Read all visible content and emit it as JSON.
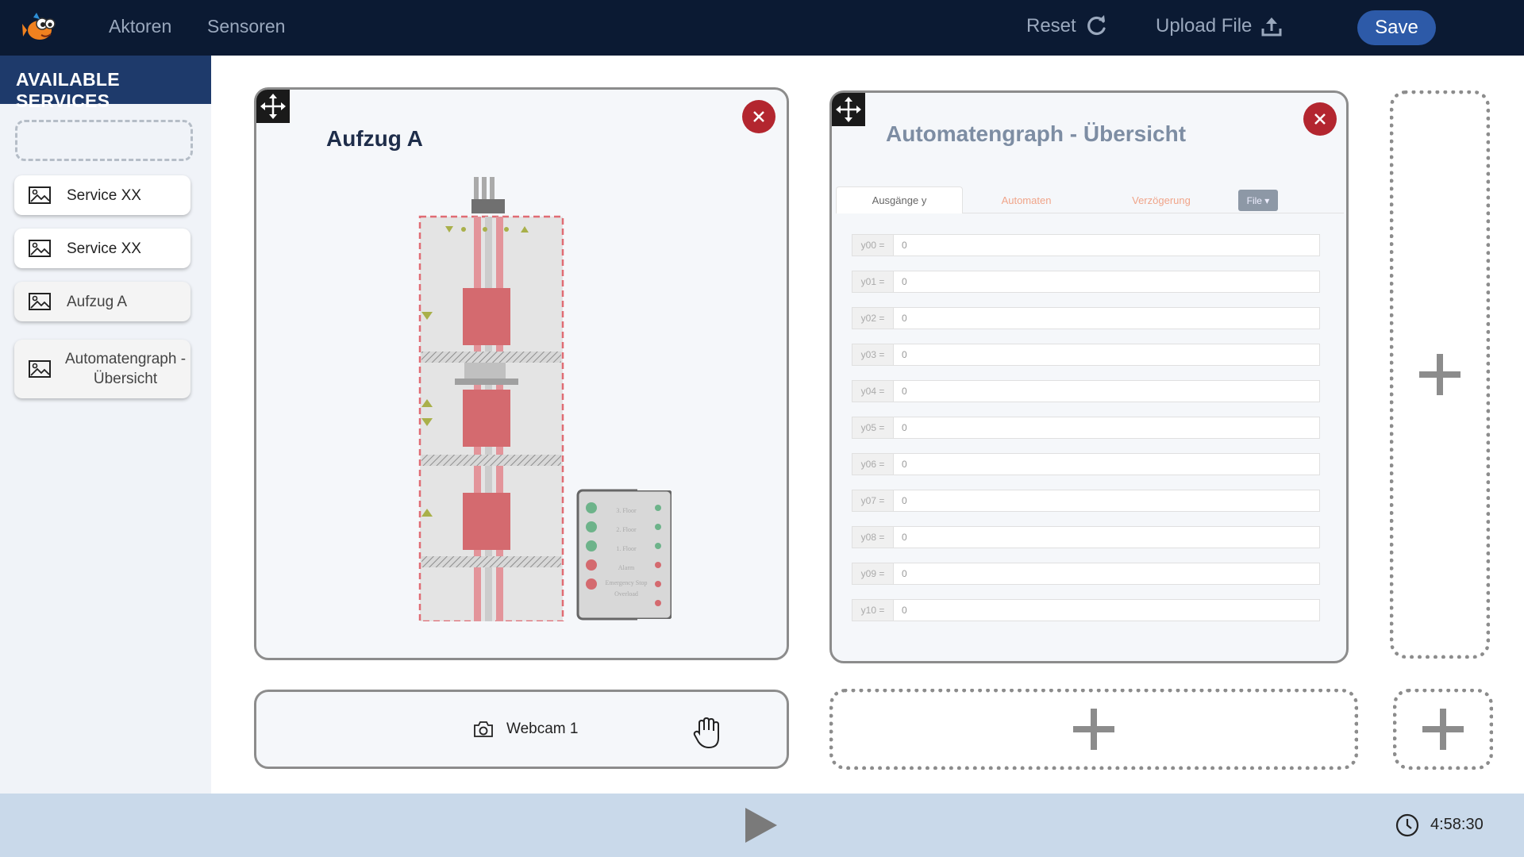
{
  "topbar": {
    "nav": [
      "Aktoren",
      "Sensoren"
    ],
    "reset_label": "Reset",
    "upload_label": "Upload File",
    "save_label": "Save"
  },
  "sidebar": {
    "header": "AVAILABLE SERVICES",
    "items": [
      {
        "label": "Service XX"
      },
      {
        "label": "Service XX"
      },
      {
        "label": "Aufzug A"
      },
      {
        "label": "Automatengraph - Übersicht"
      }
    ]
  },
  "aufzug_card": {
    "title": "Aufzug A",
    "panel_labels": [
      "3. Floor",
      "2. Floor",
      "1. Floor",
      "Alarm",
      "Emergency Stop",
      "Overload"
    ]
  },
  "automaten_card": {
    "title": "Automatengraph - Übersicht",
    "tabs": [
      "Ausgänge y",
      "Automaten",
      "Verzögerung"
    ],
    "file_label": "File ▾",
    "rows": [
      {
        "label": "y00 =",
        "value": "0"
      },
      {
        "label": "y01 =",
        "value": "0"
      },
      {
        "label": "y02 =",
        "value": "0"
      },
      {
        "label": "y03 =",
        "value": "0"
      },
      {
        "label": "y04 =",
        "value": "0"
      },
      {
        "label": "y05 =",
        "value": "0"
      },
      {
        "label": "y06 =",
        "value": "0"
      },
      {
        "label": "y07 =",
        "value": "0"
      },
      {
        "label": "y08 =",
        "value": "0"
      },
      {
        "label": "y09 =",
        "value": "0"
      },
      {
        "label": "y10 =",
        "value": "0"
      }
    ]
  },
  "webcam_card": {
    "label": "Webcam 1"
  },
  "bottombar": {
    "time": "4:58:30"
  },
  "colors": {
    "topbar": "#0b1a33",
    "sidebar_header": "#1e3a6b",
    "save_button": "#2d5aa8",
    "close_button": "#b3262f",
    "bottombar": "#c9d9ea",
    "elevator_car": "#d46a6f"
  }
}
